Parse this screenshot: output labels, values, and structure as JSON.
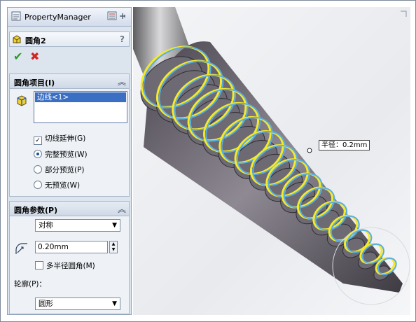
{
  "property_manager": {
    "title": "PropertyManager",
    "feature_name": "圆角2",
    "help_label": "?",
    "ok_label": "✔",
    "cancel_label": "✖"
  },
  "fillet_items": {
    "header": "圆角项目(I)",
    "selected_edge": "边线<1>",
    "tangent_propagation_label": "切线延伸(G)",
    "tangent_propagation_checked": true,
    "preview_options": [
      {
        "label": "完整预览(W)",
        "selected": true
      },
      {
        "label": "部分预览(P)",
        "selected": false
      },
      {
        "label": "无预览(W)",
        "selected": false
      }
    ]
  },
  "fillet_params": {
    "header": "圆角参数(P)",
    "method": "对称",
    "radius_value": "0.20mm",
    "multi_radius_label": "多半径圆角(M)",
    "multi_radius_checked": false,
    "profile_label": "轮廓(P)：",
    "profile_value": "圆形"
  },
  "viewport": {
    "radius_tooltip": "半径：0.2mm"
  },
  "colors": {
    "selection_blue": "#3a6fc4",
    "edge_highlight": "#f5ea2a",
    "fillet_preview": "#5aaee0"
  }
}
